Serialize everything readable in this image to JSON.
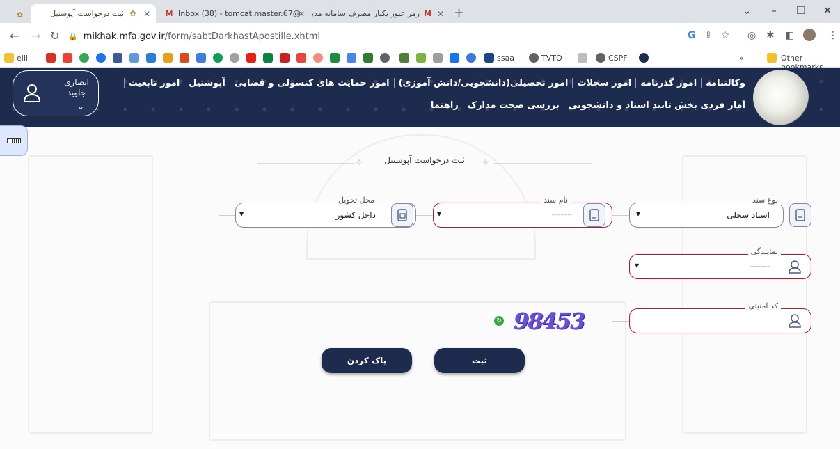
{
  "browser": {
    "tabs": [
      {
        "title": "ثبت درخواست آپوستیل",
        "active": true
      },
      {
        "title": "Inbox (38) - tomcat.master.67@",
        "active": false
      },
      {
        "title": "رمز عبور یکبار مصرف سامانه مدیری",
        "active": false
      }
    ],
    "address": {
      "host": "mikhak.mfa.gov.ir",
      "path": "/form/sabtDarkhastApostille.xhtml"
    },
    "bookmarks": {
      "items": [
        "eili",
        "ssaa",
        "TVTO",
        "CSPF"
      ],
      "more_label": "»",
      "other_label": "Other bookmarks"
    },
    "colors": {
      "chrome": "#dee1e6",
      "header": "#1d2b4f",
      "required": "#c8102e",
      "captcha": "#6a4fd8"
    }
  },
  "site": {
    "menu_row1": [
      "وکالتنامه",
      "امور گذرنامه",
      "امور سجلات",
      "امور تحصیلی(دانشجویی/دانش آموزی)",
      "امور حمایت های کنسولی و قضایی",
      "آپوستیل",
      "امور تابعیت"
    ],
    "menu_row2": [
      "آمار فردی بخش تایید اسناد و دانشجویی",
      "بررسی صحت مدارک",
      "راهنما"
    ],
    "user": {
      "first": "انصاری",
      "last": "جاوید"
    }
  },
  "form": {
    "title": "ثبت درخواست آپوستیل",
    "doc_type": {
      "label": "نوع سند",
      "value": "اسناد سجلی"
    },
    "doc_name": {
      "label": "نام سند",
      "value": "---------"
    },
    "delivery": {
      "label": "محل تحویل",
      "value": "داخل کشور"
    },
    "representation": {
      "label": "نمایندگی",
      "value": "---------"
    },
    "security_code": {
      "label": "کد امنیتی",
      "value": "",
      "captcha": "98453"
    },
    "submit_label": "ثبت",
    "clear_label": "پاک کردن"
  }
}
